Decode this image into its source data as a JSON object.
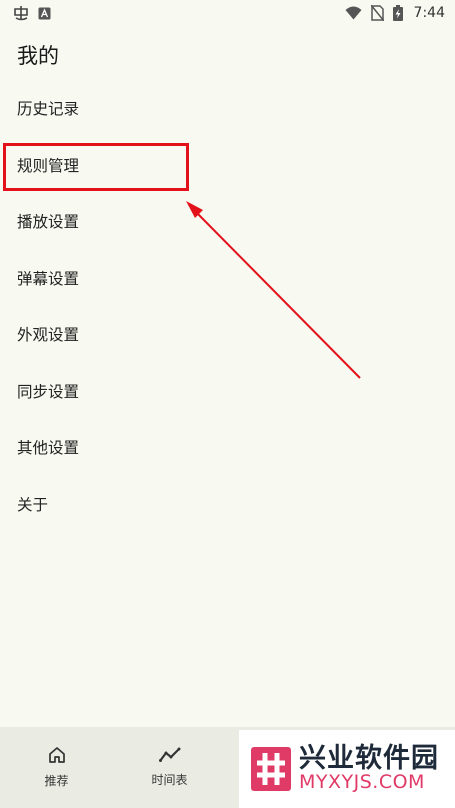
{
  "status_bar": {
    "time": "7:44",
    "icons": [
      "app-notification-icon",
      "a-badge-icon",
      "wifi-icon",
      "no-sim-icon",
      "battery-charging-icon"
    ]
  },
  "page": {
    "title": "我的"
  },
  "menu": {
    "items": [
      {
        "label": "历史记录"
      },
      {
        "label": "规则管理"
      },
      {
        "label": "播放设置"
      },
      {
        "label": "弹幕设置"
      },
      {
        "label": "外观设置"
      },
      {
        "label": "同步设置"
      },
      {
        "label": "其他设置"
      },
      {
        "label": "关于"
      }
    ]
  },
  "annotation": {
    "highlighted_item": "规则管理",
    "color": "#e3121a"
  },
  "bottom_nav": {
    "tabs": [
      {
        "label": "推荐",
        "icon": "home-icon"
      },
      {
        "label": "时间表",
        "icon": "trend-line-icon"
      }
    ]
  },
  "watermark": {
    "cn": "兴业软件园",
    "en": "MYXYJS.COM",
    "accent": "#e03a66"
  }
}
